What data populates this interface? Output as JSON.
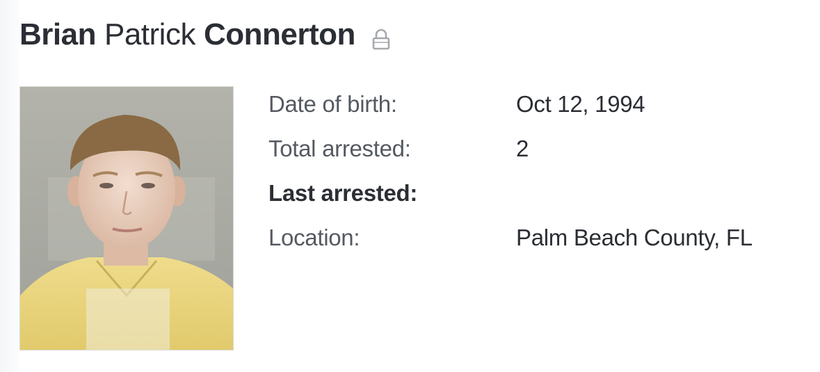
{
  "person": {
    "first_name": "Brian",
    "middle_name": "Patrick",
    "last_name": "Connerton",
    "lock_icon": "lock-icon"
  },
  "photo": {
    "icon": "mugshot-photo"
  },
  "details": [
    {
      "label": "Date of birth:",
      "value": "Oct 12, 1994"
    },
    {
      "label": "Total arrested:",
      "value": "2"
    },
    {
      "label": "Last arrested:",
      "value": ""
    },
    {
      "label": "Location:",
      "value": "Palm Beach County, FL"
    }
  ],
  "colors": {
    "text_dark": "#2b2e34",
    "text_muted": "#555a61",
    "background": "#ffffff",
    "shirt": "#e8d47a"
  }
}
